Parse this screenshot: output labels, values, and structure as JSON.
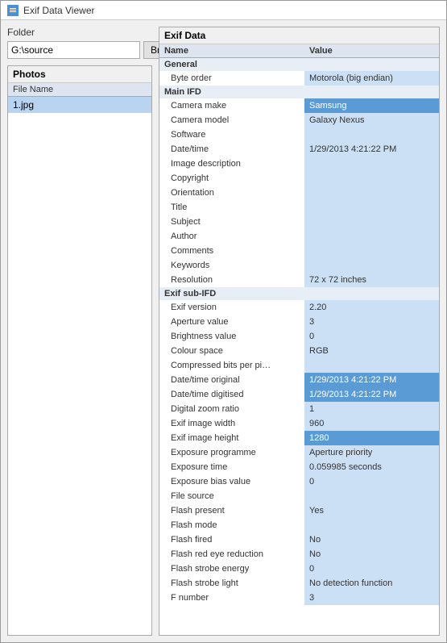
{
  "titleBar": {
    "title": "Exif Data Viewer",
    "icon": "exif-icon"
  },
  "leftPanel": {
    "folderLabel": "Folder",
    "folderPath": "G:\\source",
    "browseLabel": "Browse",
    "photosLabel": "Photos",
    "photosColumnHeader": "File Name",
    "photoItems": [
      {
        "name": "1.jpg",
        "selected": true
      }
    ]
  },
  "rightPanel": {
    "exifLabel": "Exif Data",
    "columnHeaders": {
      "name": "Name",
      "value": "Value"
    },
    "sections": [
      {
        "sectionName": "General",
        "rows": [
          {
            "name": "Byte order",
            "value": "Motorola (big endian)",
            "highlight": false
          }
        ]
      },
      {
        "sectionName": "Main IFD",
        "rows": [
          {
            "name": "Camera make",
            "value": "Samsung",
            "highlight": true
          },
          {
            "name": "Camera model",
            "value": "Galaxy Nexus",
            "highlight": false
          },
          {
            "name": "Software",
            "value": "",
            "highlight": false
          },
          {
            "name": "Date/time",
            "value": "1/29/2013 4:21:22 PM",
            "highlight": false
          },
          {
            "name": "Image description",
            "value": "",
            "highlight": false
          },
          {
            "name": "Copyright",
            "value": "",
            "highlight": false
          },
          {
            "name": "Orientation",
            "value": "",
            "highlight": false
          },
          {
            "name": "Title",
            "value": "",
            "highlight": false
          },
          {
            "name": "Subject",
            "value": "",
            "highlight": false
          },
          {
            "name": "Author",
            "value": "",
            "highlight": false
          },
          {
            "name": "Comments",
            "value": "",
            "highlight": false
          },
          {
            "name": "Keywords",
            "value": "",
            "highlight": false
          },
          {
            "name": "Resolution",
            "value": "72 x 72 inches",
            "highlight": false
          }
        ]
      },
      {
        "sectionName": "Exif sub-IFD",
        "rows": [
          {
            "name": "Exif version",
            "value": "2.20",
            "highlight": false
          },
          {
            "name": "Aperture value",
            "value": "3",
            "highlight": false
          },
          {
            "name": "Brightness value",
            "value": "0",
            "highlight": false
          },
          {
            "name": "Colour space",
            "value": "RGB",
            "highlight": false
          },
          {
            "name": "Compressed bits per pi…",
            "value": "",
            "highlight": false
          },
          {
            "name": "Date/time original",
            "value": "1/29/2013 4:21:22 PM",
            "highlight": true
          },
          {
            "name": "Date/time digitised",
            "value": "1/29/2013 4:21:22 PM",
            "highlight": true
          },
          {
            "name": "Digital zoom ratio",
            "value": "1",
            "highlight": false
          },
          {
            "name": "Exif image width",
            "value": "960",
            "highlight": false
          },
          {
            "name": "Exif image height",
            "value": "1280",
            "highlight": true
          },
          {
            "name": "Exposure programme",
            "value": "Aperture priority",
            "highlight": false
          },
          {
            "name": "Exposure time",
            "value": "0.059985 seconds",
            "highlight": false
          },
          {
            "name": "Exposure bias value",
            "value": "0",
            "highlight": false
          },
          {
            "name": "File source",
            "value": "",
            "highlight": false
          },
          {
            "name": "Flash present",
            "value": "Yes",
            "highlight": false
          },
          {
            "name": "Flash mode",
            "value": "",
            "highlight": false
          },
          {
            "name": "Flash fired",
            "value": "No",
            "highlight": false
          },
          {
            "name": "Flash red eye reduction",
            "value": "No",
            "highlight": false
          },
          {
            "name": "Flash strobe energy",
            "value": "0",
            "highlight": false
          },
          {
            "name": "Flash strobe light",
            "value": "No detection function",
            "highlight": false
          },
          {
            "name": "F number",
            "value": "3",
            "highlight": false
          }
        ]
      }
    ]
  }
}
